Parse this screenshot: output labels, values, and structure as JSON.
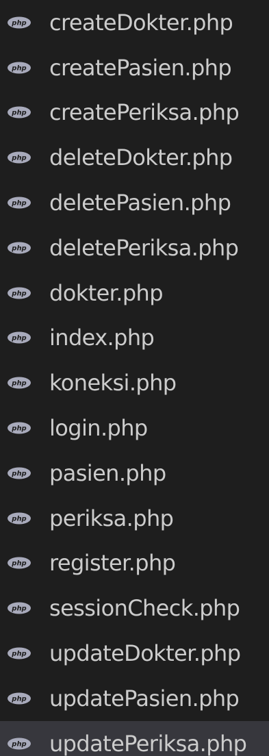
{
  "explorer": {
    "selected_index": 16,
    "files": [
      {
        "name": "createDokter.php",
        "icon": "php-file-icon"
      },
      {
        "name": "createPasien.php",
        "icon": "php-file-icon"
      },
      {
        "name": "createPeriksa.php",
        "icon": "php-file-icon"
      },
      {
        "name": "deleteDokter.php",
        "icon": "php-file-icon"
      },
      {
        "name": "deletePasien.php",
        "icon": "php-file-icon"
      },
      {
        "name": "deletePeriksa.php",
        "icon": "php-file-icon"
      },
      {
        "name": "dokter.php",
        "icon": "php-file-icon"
      },
      {
        "name": "index.php",
        "icon": "php-file-icon"
      },
      {
        "name": "koneksi.php",
        "icon": "php-file-icon"
      },
      {
        "name": "login.php",
        "icon": "php-file-icon"
      },
      {
        "name": "pasien.php",
        "icon": "php-file-icon"
      },
      {
        "name": "periksa.php",
        "icon": "php-file-icon"
      },
      {
        "name": "register.php",
        "icon": "php-file-icon"
      },
      {
        "name": "sessionCheck.php",
        "icon": "php-file-icon"
      },
      {
        "name": "updateDokter.php",
        "icon": "php-file-icon"
      },
      {
        "name": "updatePasien.php",
        "icon": "php-file-icon"
      },
      {
        "name": "updatePeriksa.php",
        "icon": "php-file-icon"
      }
    ]
  },
  "colors": {
    "background": "#1e1e1e",
    "selected_row": "#37373d",
    "text": "#cccccc",
    "icon": "#a8aabb"
  }
}
